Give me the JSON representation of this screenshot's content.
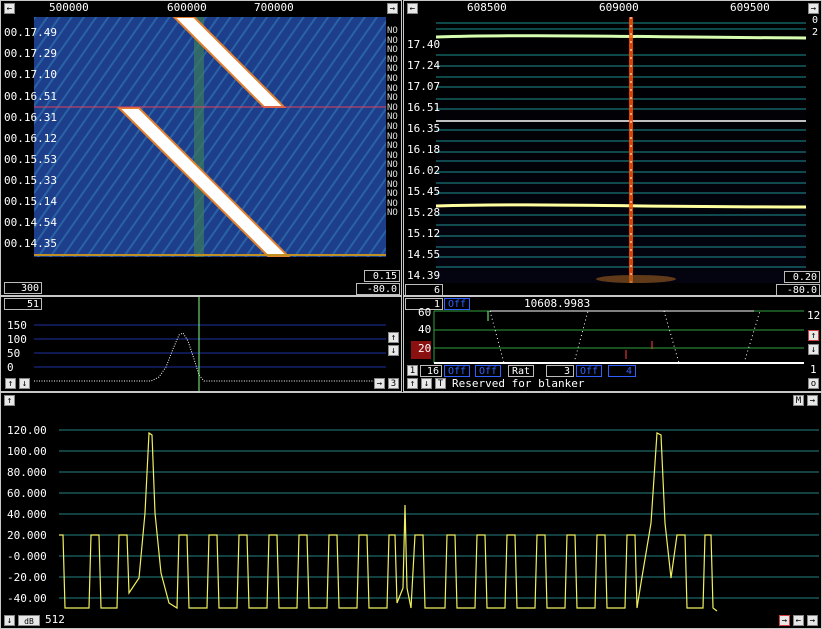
{
  "left_waterfall": {
    "freq_labels": [
      "500000",
      "600000",
      "700000"
    ],
    "time_labels": [
      "00.17.49",
      "00.17.29",
      "00.17.10",
      "00.16.51",
      "00.16.31",
      "00.16.12",
      "00.15.53",
      "00.15.33",
      "00.15.14",
      "00.14.54",
      "00.14.35"
    ],
    "no_labels": [
      "NO",
      "NO",
      "NO",
      "NO",
      "NO",
      "NO",
      "NO",
      "NO",
      "NO",
      "NO",
      "NO",
      "NO",
      "NO",
      "NO",
      "NO",
      "NO",
      "NO",
      "NO",
      "NO",
      "NO"
    ],
    "box_left": "300",
    "box_right_top": "0.15",
    "box_right_bottom": "-80.0",
    "colors": {
      "bg": "#1e3f8c",
      "stripe": "#ffffff",
      "line": "#e04060"
    }
  },
  "right_waterfall": {
    "freq_labels": [
      "608500",
      "609000",
      "609500"
    ],
    "time_labels": [
      "17.40",
      "17.24",
      "17.07",
      "16.51",
      "16.35",
      "16.18",
      "16.02",
      "15.45",
      "15.28",
      "15.12",
      "14.55",
      "14.39"
    ],
    "side_top": "0",
    "side_second": "2",
    "box_left": "6",
    "box_right_top": "0.20",
    "box_right_bottom": "-80.0"
  },
  "left_spectrum": {
    "box": "51",
    "y_labels": [
      "150",
      "100",
      "50",
      "0"
    ],
    "right_value": "3"
  },
  "right_spectrum": {
    "box_left": "1",
    "off_label": "Off",
    "freq_readout": "10608.9983",
    "y_labels": [
      "60",
      "40",
      "20"
    ],
    "right_top": "12",
    "right_bottom": "1",
    "right_o": "o",
    "ctrl_num": "16",
    "ctrl_off1": "Off",
    "ctrl_off2": "Off",
    "rat_label": "Rat",
    "rat_value": "3",
    "off3": "Off",
    "off3_value": "4",
    "status": "Reserved for blanker"
  },
  "bottom_graph": {
    "y_labels": [
      "120.00",
      "100.00",
      "80.000",
      "60.000",
      "40.000",
      "20.000",
      "-0.000",
      "-20.00",
      "-40.00"
    ],
    "m_label": "M",
    "db_label": "dB",
    "bins": "512"
  }
}
